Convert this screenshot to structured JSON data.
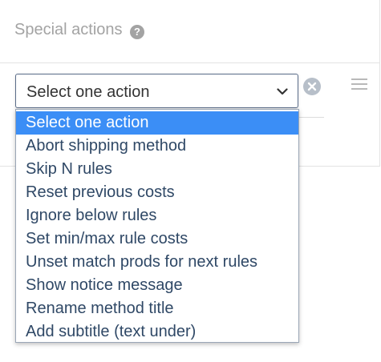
{
  "section": {
    "title": "Special actions",
    "help_icon": "question-circle-icon"
  },
  "action_select": {
    "value": "Select one action",
    "chevron_icon": "chevron-down-icon",
    "remove_icon": "remove-circle-icon",
    "drag_icon": "hamburger-menu-icon"
  },
  "dropdown": {
    "selected_index": 0,
    "options": [
      "Select one action",
      "Abort shipping method",
      "Skip N rules",
      "Reset previous costs",
      "Ignore below rules",
      "Set min/max rule costs",
      "Unset match prods for next rules",
      "Show notice message",
      "Rename method title",
      "Add subtitle (text under)"
    ]
  },
  "colors": {
    "highlight": "#3b8ef6",
    "option_text": "#2f4866",
    "muted_text": "#a3a3a3"
  }
}
